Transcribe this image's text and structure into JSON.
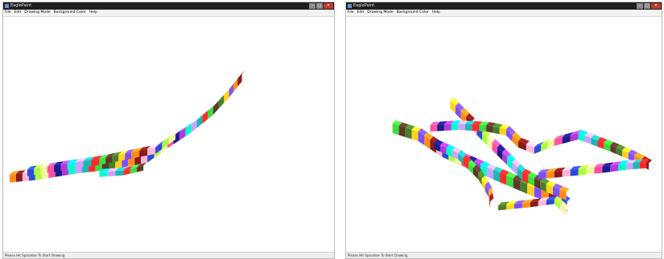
{
  "windows": [
    {
      "title": "EaglePaint",
      "menu": [
        "File",
        "Edit",
        "Drawing Mode",
        "Background Color",
        "Help"
      ],
      "status": "Please Hit Spacebar To Start Drawing"
    },
    {
      "title": "EaglePaint",
      "menu": [
        "File",
        "Edit",
        "Drawing Mode",
        "Background Color",
        "Help"
      ],
      "status": "Please Hit Spacebar To Start Drawing"
    }
  ],
  "window_controls": {
    "minimize": "–",
    "maximize": "□",
    "close": "✕"
  },
  "palette": [
    "#ff8c1a",
    "#3ddc3d",
    "#b03ad6",
    "#2f4ad8",
    "#ffd21f",
    "#1fb5b5",
    "#ff4fa3",
    "#8b1a1a",
    "#5b3a29",
    "#00ffd0",
    "#a7ff3d",
    "#7a4fff",
    "#ff2b2b",
    "#1c1c8a",
    "#ffb6d9",
    "#4a7d2b",
    "#c8a2ff",
    "#f5f5a0"
  ]
}
